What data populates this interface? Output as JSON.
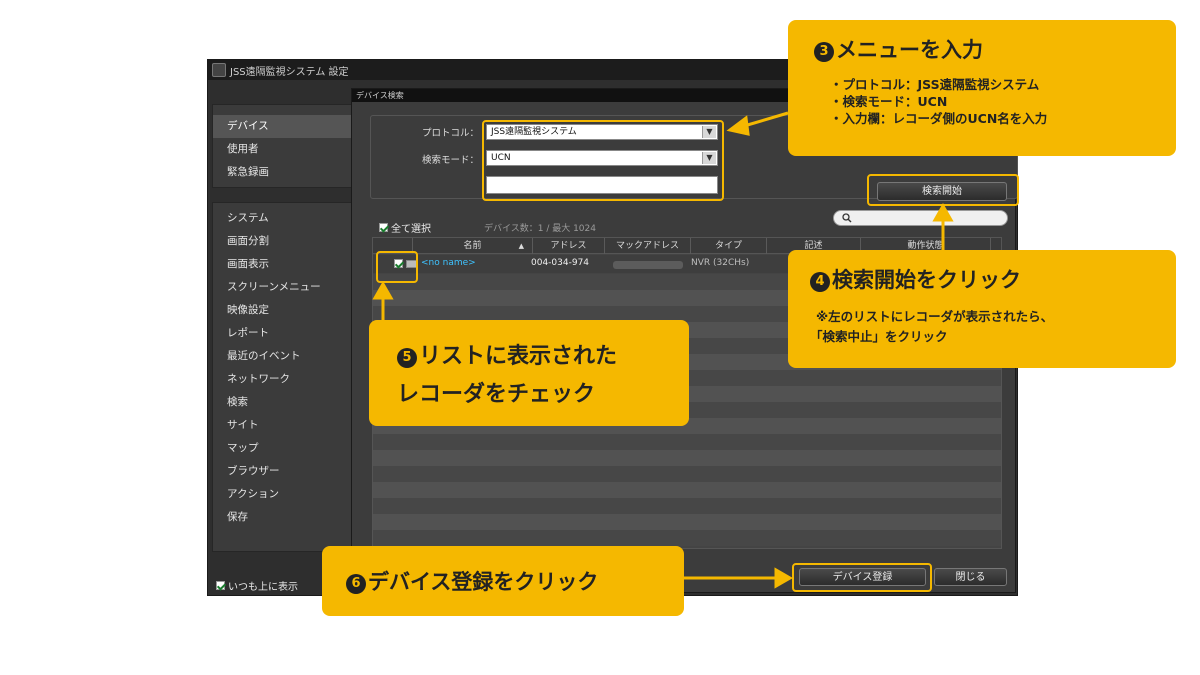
{
  "window": {
    "title": "JSS遠隔監視システム 設定"
  },
  "sidebar": {
    "group1": [
      {
        "label": "デバイス",
        "active": true
      },
      {
        "label": "使用者"
      },
      {
        "label": "緊急録画"
      }
    ],
    "group2": [
      {
        "label": "システム"
      },
      {
        "label": "画面分割"
      },
      {
        "label": "画面表示"
      },
      {
        "label": "スクリーンメニュー"
      },
      {
        "label": "映像設定"
      },
      {
        "label": "レポート"
      },
      {
        "label": "最近のイベント"
      },
      {
        "label": "ネットワーク"
      },
      {
        "label": "検索"
      },
      {
        "label": "サイト"
      },
      {
        "label": "マップ"
      },
      {
        "label": "ブラウザー"
      },
      {
        "label": "アクション"
      },
      {
        "label": "保存"
      }
    ],
    "always_on_top": "いつも上に表示"
  },
  "dialog": {
    "title": "デバイス検索",
    "protocol_label": "プロトコル：",
    "protocol_value": "JSS遠隔監視システム",
    "search_mode_label": "検索モード：",
    "search_mode_value": "UCN",
    "ucn_input_value": "",
    "search_start_button": "検索開始",
    "select_all": "全て選択",
    "device_count": "デバイス数：1 / 最大 1024",
    "table": {
      "columns": [
        "名前",
        "アドレス",
        "マックアドレス",
        "タイプ",
        "記述",
        "動作状態"
      ],
      "rows": [
        {
          "name": "<no name>",
          "address": "004-034-974",
          "mac": "",
          "type": "NVR (32CHs)",
          "description": "",
          "status": ""
        }
      ]
    },
    "register_button": "デバイス登録",
    "close_button": "閉じる"
  },
  "callouts": {
    "step3": {
      "number": "3",
      "heading": "メニューを入力",
      "bullets": [
        "・プロトコル：JSS遠隔監視システム",
        "・検索モード：UCN",
        "・入力欄：レコーダ側のUCN名を入力"
      ]
    },
    "step4": {
      "number": "4",
      "heading": "検索開始をクリック",
      "note_line1": "※左のリストにレコーダが表示されたら、",
      "note_line2": "「検索中止」をクリック"
    },
    "step5": {
      "number": "5",
      "line1": "リストに表示された",
      "line2": "レコーダをチェック"
    },
    "step6": {
      "number": "6",
      "heading": "デバイス登録をクリック"
    }
  },
  "colors": {
    "accent": "#f5b800",
    "link_cyan": "#3ec3ff"
  }
}
